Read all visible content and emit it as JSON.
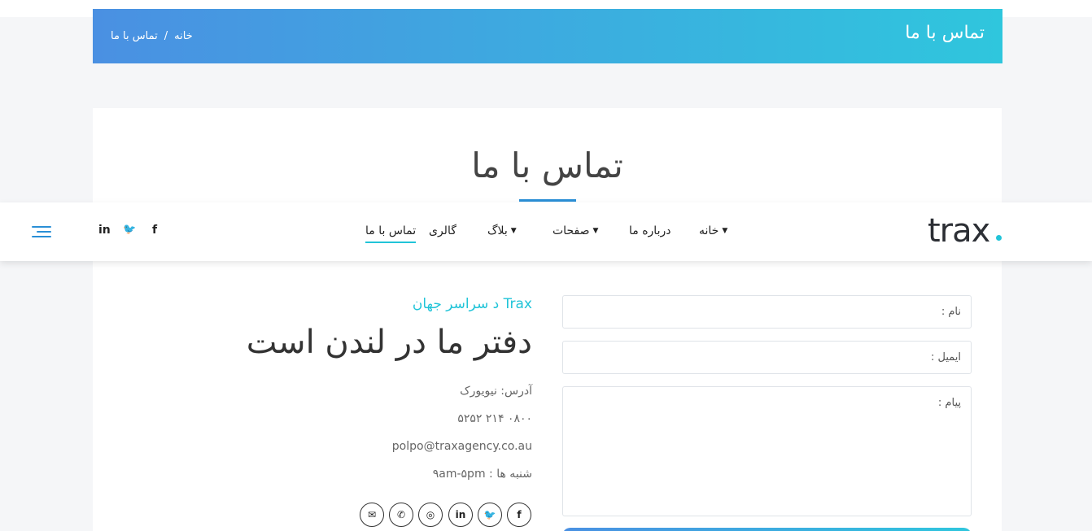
{
  "banner": {
    "title": "تماس با ما",
    "breadcrumb": {
      "home": "خانه",
      "separator": "/",
      "current": "تماس با ما"
    }
  },
  "section": {
    "title": "تماس با ما"
  },
  "nav": {
    "logo": "trax",
    "items": [
      {
        "label": "خانه",
        "has_dropdown": true
      },
      {
        "label": "درباره ما",
        "has_dropdown": false
      },
      {
        "label": "صفحات",
        "has_dropdown": true
      },
      {
        "label": "بلاگ",
        "has_dropdown": true
      },
      {
        "label": "گالری",
        "has_dropdown": false
      },
      {
        "label": "تماس با ما",
        "has_dropdown": false,
        "active": true
      }
    ],
    "social": [
      {
        "icon": "facebook-icon",
        "glyph": "f"
      },
      {
        "icon": "twitter-icon",
        "glyph": "🐦"
      },
      {
        "icon": "linkedin-icon",
        "glyph": "in"
      }
    ],
    "chevron_glyph": "▼"
  },
  "contact": {
    "eyebrow": "Trax د سراسر جهان",
    "headline": "دفتر ما در لندن است",
    "address": "آدرس: نیویورک",
    "phone": "۰۸۰۰ ۲۱۴ ۵۲۵۲",
    "email": "polpo@traxagency.co.au",
    "hours": "شنبه ها : ۹am-۵pm",
    "social": [
      {
        "icon": "facebook-icon",
        "glyph": "f"
      },
      {
        "icon": "twitter-icon",
        "glyph": "🐦"
      },
      {
        "icon": "linkedin-icon",
        "glyph": "in"
      },
      {
        "icon": "instagram-icon",
        "glyph": "◎"
      },
      {
        "icon": "whatsapp-icon",
        "glyph": "✆"
      },
      {
        "icon": "mail-icon",
        "glyph": "✉"
      }
    ]
  },
  "form": {
    "name_label": "نام :",
    "email_label": "ایمیل :",
    "message_label": "پیام :"
  },
  "colors": {
    "accent": "#21c4d8",
    "blue": "#4a90e2",
    "underline": "#2a8fd6"
  }
}
